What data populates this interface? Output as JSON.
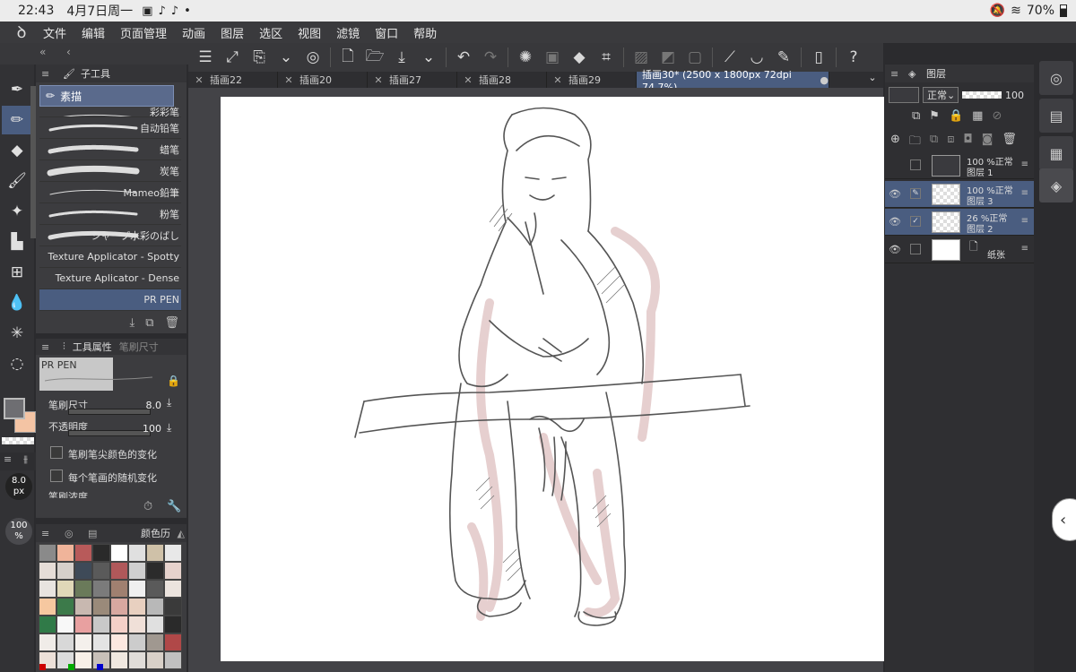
{
  "status": {
    "time": "22:43",
    "date": "4月7日周一",
    "battery": "70%"
  },
  "menu": {
    "items": [
      "文件",
      "编辑",
      "页面管理",
      "动画",
      "图层",
      "选区",
      "视图",
      "滤镜",
      "窗口",
      "帮助"
    ]
  },
  "tabs": {
    "items": [
      "插画22",
      "插画20",
      "插画27",
      "插画28",
      "插画29"
    ],
    "active": "插画30* (2500 x 1800px 72dpi 74.7%)"
  },
  "subtool": {
    "title": "子工具",
    "selected": "素描",
    "brushes": [
      "彩彩笔",
      "自动铅笔",
      "蜡笔",
      "炭笔",
      "Mameo鉛筆",
      "粉笔",
      "シャープ水彩のばし",
      "Texture Applicator - Spotty",
      "Texture Aplicator - Dense",
      "PR PEN"
    ]
  },
  "toolprop": {
    "title": "工具属性",
    "tab2": "笔刷尺寸",
    "preview_label": "PR PEN",
    "size_label": "笔刷尺寸",
    "size_value": "8.0",
    "opacity_label": "不透明度",
    "opacity_value": "100",
    "check1": "笔刷笔尖颜色的变化",
    "check2": "每个笔画的随机变化",
    "density_label": "笔刷浓度"
  },
  "leftcol": {
    "size_badge": "8.0",
    "size_unit": "px",
    "opacity_badge": "100",
    "opacity_unit": "%"
  },
  "palette": {
    "title": "颜色历",
    "colors": [
      "#8a8a8a",
      "#f0b49a",
      "#b85a5a",
      "#2a2a2a",
      "#ffffff",
      "#e0e0e0",
      "#cfc1a8",
      "#e8e8e8",
      "#e6ddd7",
      "#d6d0cb",
      "#3e4a58",
      "#5a5a5a",
      "#b0585a",
      "#cfcfcf",
      "#2b2b2b",
      "#e6d2cc",
      "#e8e4e0",
      "#e0d8b8",
      "#6a7a5a",
      "#7b7b7b",
      "#a08070",
      "#f0f0f0",
      "#5a5a5a",
      "#ece4de",
      "#f6c8a0",
      "#3c7a4a",
      "#c8b8b0",
      "#9a8a7a",
      "#d8a8a0",
      "#e8d0c0",
      "#b8b8b8",
      "#3a3a3a",
      "#307a48",
      "#f8f8f8",
      "#e8a0a0",
      "#c8c8c8",
      "#f4d0c8",
      "#f0e0d8",
      "#e0e0e0",
      "#2a2a2a",
      "#f0ece8",
      "#d8d8d8",
      "#f4f0ec",
      "#e4e4e4",
      "#fce8e0",
      "#cccccc",
      "#a09890",
      "#b04848",
      "#ece0d8",
      "#dcdcdc",
      "#f8f0e8",
      "#c8c0b8",
      "#f0e8e0",
      "#e0dcd8",
      "#d8d0c8",
      "#c0c0c0"
    ]
  },
  "layers": {
    "title": "图层",
    "blend": "正常",
    "opacity": "100",
    "rows": [
      {
        "pct": "100 %正常",
        "name": "图层 1"
      },
      {
        "pct": "100 %正常",
        "name": "图层 3"
      },
      {
        "pct": "26 %正常",
        "name": "图层 2"
      },
      {
        "pct": "",
        "name": "纸张"
      }
    ]
  },
  "colors": {
    "accent": "#4a5d80",
    "main_color": "#6e6e72",
    "sub_color": "#f4c4a4"
  }
}
